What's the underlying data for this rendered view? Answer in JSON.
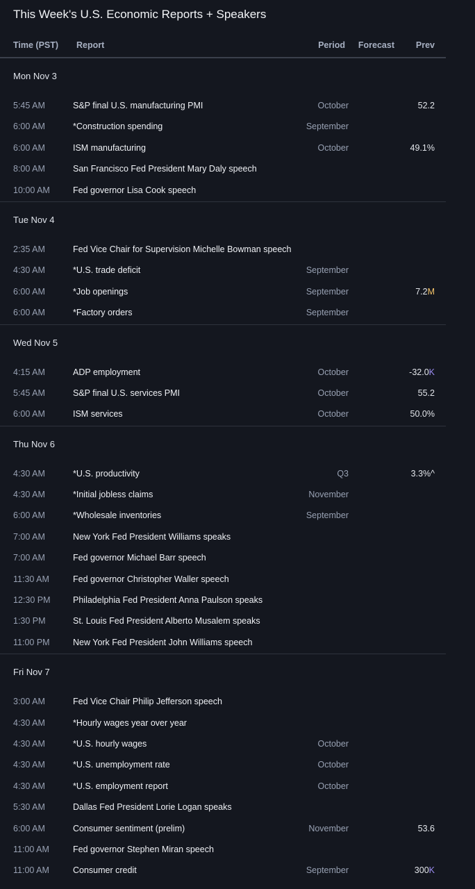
{
  "title": "This Week's U.S. Economic Reports + Speakers",
  "columns": {
    "time": "Time (PST)",
    "report": "Report",
    "period": "Period",
    "forecast": "Forecast",
    "prev": "Prev"
  },
  "unit_colors": {
    "M": "#f5c46a",
    "K": "#9b8cf2"
  },
  "days": [
    {
      "label": "Mon Nov 3",
      "rows": [
        {
          "time": "5:45 AM",
          "report": "S&P final U.S. manufacturing PMI",
          "period": "October",
          "forecast": "",
          "prev": "52.2",
          "prev_unit": ""
        },
        {
          "time": "6:00 AM",
          "report": "*Construction spending",
          "period": "September",
          "forecast": "",
          "prev": "",
          "prev_unit": ""
        },
        {
          "time": "6:00 AM",
          "report": "ISM manufacturing",
          "period": "October",
          "forecast": "",
          "prev": "49.1%",
          "prev_unit": ""
        },
        {
          "time": "8:00 AM",
          "report": "San Francisco Fed President Mary Daly speech",
          "period": "",
          "forecast": "",
          "prev": "",
          "prev_unit": ""
        },
        {
          "time": "10:00 AM",
          "report": "Fed governor Lisa Cook speech",
          "period": "",
          "forecast": "",
          "prev": "",
          "prev_unit": ""
        }
      ]
    },
    {
      "label": "Tue Nov 4",
      "rows": [
        {
          "time": "2:35 AM",
          "report": "Fed Vice Chair for Supervision Michelle Bowman speech",
          "period": "",
          "forecast": "",
          "prev": "",
          "prev_unit": ""
        },
        {
          "time": "4:30 AM",
          "report": "*U.S. trade deficit",
          "period": "September",
          "forecast": "",
          "prev": "",
          "prev_unit": ""
        },
        {
          "time": "6:00 AM",
          "report": "*Job openings",
          "period": "September",
          "forecast": "",
          "prev": "7.2",
          "prev_unit": "M"
        },
        {
          "time": "6:00 AM",
          "report": "*Factory orders",
          "period": "September",
          "forecast": "",
          "prev": "",
          "prev_unit": ""
        }
      ]
    },
    {
      "label": "Wed Nov 5",
      "rows": [
        {
          "time": "4:15 AM",
          "report": "ADP employment",
          "period": "October",
          "forecast": "",
          "prev": "-32.0",
          "prev_unit": "K"
        },
        {
          "time": "5:45 AM",
          "report": "S&P final U.S. services PMI",
          "period": "October",
          "forecast": "",
          "prev": "55.2",
          "prev_unit": ""
        },
        {
          "time": "6:00 AM",
          "report": "ISM services",
          "period": "October",
          "forecast": "",
          "prev": "50.0%",
          "prev_unit": ""
        }
      ]
    },
    {
      "label": "Thu Nov 6",
      "rows": [
        {
          "time": "4:30 AM",
          "report": "*U.S. productivity",
          "period": "Q3",
          "forecast": "",
          "prev": "3.3%^",
          "prev_unit": ""
        },
        {
          "time": "4:30 AM",
          "report": "*Initial jobless claims",
          "period": "November",
          "forecast": "",
          "prev": "",
          "prev_unit": ""
        },
        {
          "time": "6:00 AM",
          "report": "*Wholesale inventories",
          "period": "September",
          "forecast": "",
          "prev": "",
          "prev_unit": ""
        },
        {
          "time": "7:00 AM",
          "report": "New York Fed President Williams speaks",
          "period": "",
          "forecast": "",
          "prev": "",
          "prev_unit": ""
        },
        {
          "time": "7:00 AM",
          "report": "Fed governor Michael Barr speech",
          "period": "",
          "forecast": "",
          "prev": "",
          "prev_unit": ""
        },
        {
          "time": "11:30 AM",
          "report": "Fed governor Christopher Waller speech",
          "period": "",
          "forecast": "",
          "prev": "",
          "prev_unit": ""
        },
        {
          "time": "12:30 PM",
          "report": "Philadelphia Fed President Anna Paulson speaks",
          "period": "",
          "forecast": "",
          "prev": "",
          "prev_unit": ""
        },
        {
          "time": "1:30 PM",
          "report": "St. Louis Fed President Alberto Musalem speaks",
          "period": "",
          "forecast": "",
          "prev": "",
          "prev_unit": ""
        },
        {
          "time": "11:00 PM",
          "report": "New York Fed President John Williams speech",
          "period": "",
          "forecast": "",
          "prev": "",
          "prev_unit": ""
        }
      ]
    },
    {
      "label": "Fri Nov 7",
      "rows": [
        {
          "time": "3:00 AM",
          "report": "Fed Vice Chair Philip Jefferson speech",
          "period": "",
          "forecast": "",
          "prev": "",
          "prev_unit": ""
        },
        {
          "time": "4:30 AM",
          "report": "*Hourly wages year over year",
          "period": "",
          "forecast": "",
          "prev": "",
          "prev_unit": ""
        },
        {
          "time": "4:30 AM",
          "report": "*U.S. hourly wages",
          "period": "October",
          "forecast": "",
          "prev": "",
          "prev_unit": ""
        },
        {
          "time": "4:30 AM",
          "report": "*U.S. unemployment rate",
          "period": "October",
          "forecast": "",
          "prev": "",
          "prev_unit": ""
        },
        {
          "time": "4:30 AM",
          "report": "*U.S. employment report",
          "period": "October",
          "forecast": "",
          "prev": "",
          "prev_unit": ""
        },
        {
          "time": "5:30 AM",
          "report": "Dallas Fed President Lorie Logan speaks",
          "period": "",
          "forecast": "",
          "prev": "",
          "prev_unit": ""
        },
        {
          "time": "6:00 AM",
          "report": "Consumer sentiment (prelim)",
          "period": "November",
          "forecast": "",
          "prev": "53.6",
          "prev_unit": ""
        },
        {
          "time": "11:00 AM",
          "report": "Fed governor Stephen Miran speech",
          "period": "",
          "forecast": "",
          "prev": "",
          "prev_unit": ""
        },
        {
          "time": "11:00 AM",
          "report": "Consumer credit",
          "period": "September",
          "forecast": "",
          "prev": "300",
          "prev_unit": "K"
        }
      ]
    }
  ]
}
